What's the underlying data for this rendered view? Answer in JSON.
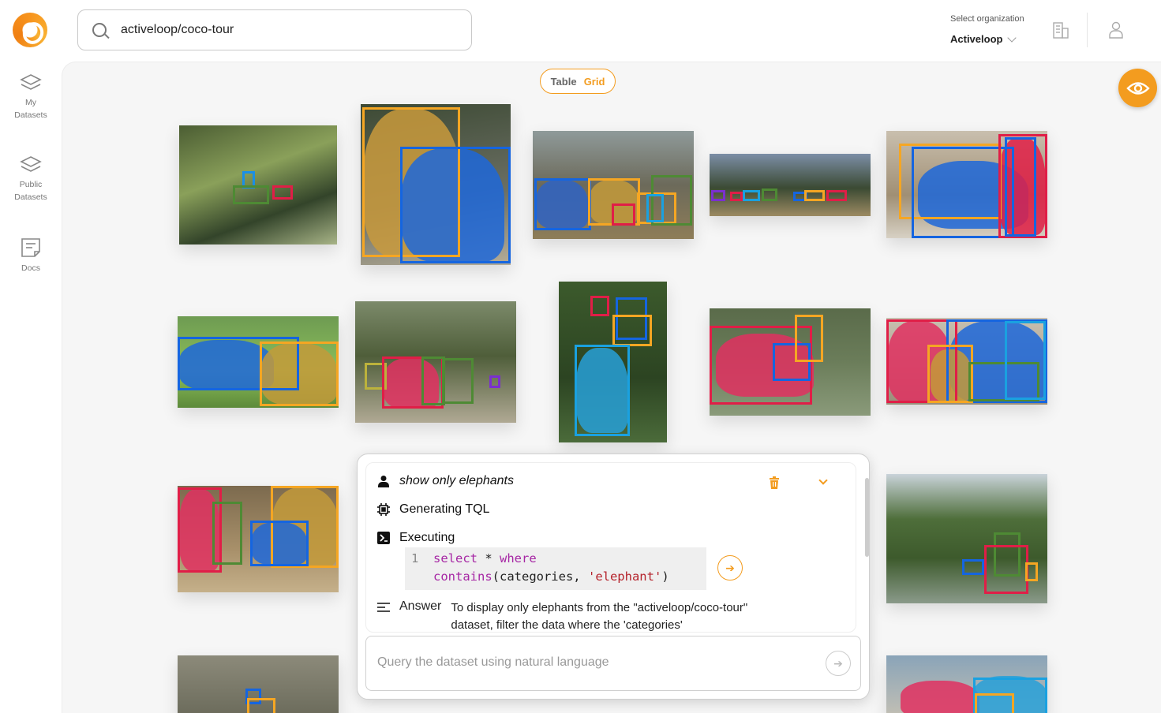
{
  "header": {
    "search_value": "activeloop/coco-tour",
    "org_label": "Select organization",
    "org_value": "Activeloop"
  },
  "sidebar": {
    "items": [
      {
        "label_1": "My",
        "label_2": "Datasets"
      },
      {
        "label_1": "Public",
        "label_2": "Datasets"
      },
      {
        "label_1": "Docs",
        "label_2": ""
      }
    ]
  },
  "view_toggle": {
    "table": "Table",
    "grid": "Grid"
  },
  "chat": {
    "user_message": "show only elephants",
    "step_generating": "Generating TQL",
    "step_executing": "Executing",
    "code_line_number": "1",
    "code_select": "select",
    "code_star": " * ",
    "code_where": "where",
    "code_contains": "contains",
    "code_args_open": "(categories, ",
    "code_string": "'elephant'",
    "code_args_close": ")",
    "answer_label": "Answer",
    "answer_text": "To display only elephants from the \"activeloop/coco-tour\" dataset, filter the data where the 'categories'",
    "query_placeholder": "Query the dataset using natural language"
  },
  "colors": {
    "accent": "#f39c1f",
    "box_blue": "#1565e0",
    "box_orange": "#f5a623",
    "box_red": "#e01e47",
    "box_green": "#4e8a34",
    "box_cyan": "#1aa1e0"
  }
}
